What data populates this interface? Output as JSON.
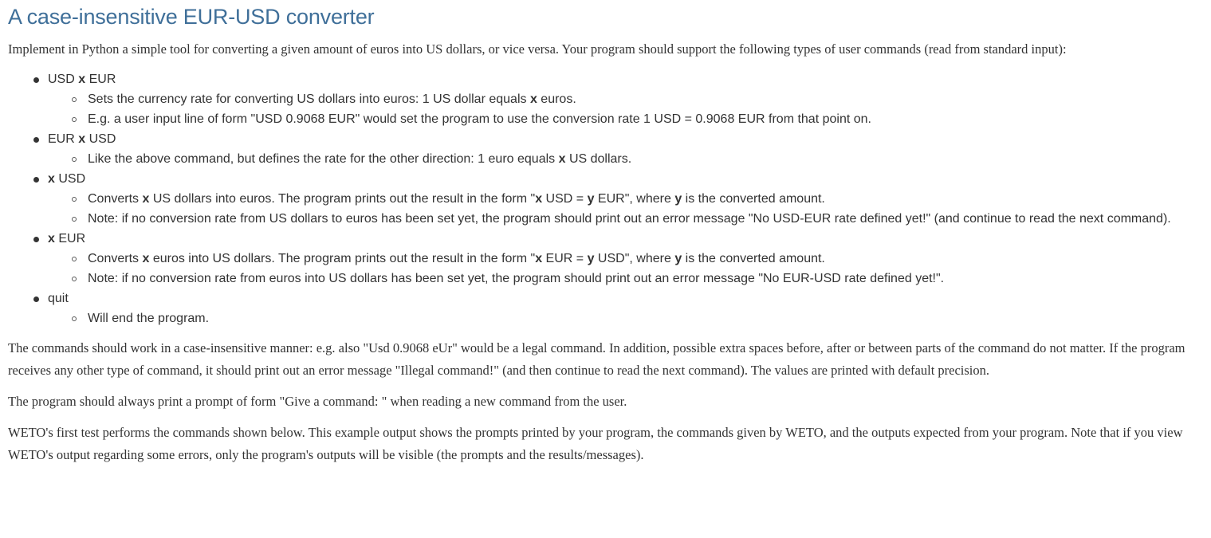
{
  "title": "A case-insensitive EUR-USD converter",
  "intro": "Implement in Python a simple tool for converting a given amount of euros into US dollars, or vice versa. Your program should support the following types of user commands (read from standard input):",
  "commands": [
    {
      "label": [
        {
          "t": "USD "
        },
        {
          "t": "x",
          "b": true
        },
        {
          "t": " EUR"
        }
      ],
      "details": [
        [
          {
            "t": "Sets the currency rate for converting US dollars into euros: 1 US dollar equals "
          },
          {
            "t": "x",
            "b": true
          },
          {
            "t": " euros."
          }
        ],
        [
          {
            "t": "E.g. a user input line of form \"USD 0.9068 EUR\" would set the program to use the conversion rate 1 USD = 0.9068 EUR from that point on."
          }
        ]
      ]
    },
    {
      "label": [
        {
          "t": "EUR "
        },
        {
          "t": "x",
          "b": true
        },
        {
          "t": " USD"
        }
      ],
      "details": [
        [
          {
            "t": "Like the above command, but defines the rate for the other direction: 1 euro equals "
          },
          {
            "t": "x",
            "b": true
          },
          {
            "t": " US dollars."
          }
        ]
      ]
    },
    {
      "label": [
        {
          "t": "x",
          "b": true
        },
        {
          "t": " USD"
        }
      ],
      "details": [
        [
          {
            "t": "Converts "
          },
          {
            "t": "x",
            "b": true
          },
          {
            "t": " US dollars into euros. The program prints out the result in the form \""
          },
          {
            "t": "x",
            "b": true
          },
          {
            "t": " USD = "
          },
          {
            "t": "y",
            "b": true
          },
          {
            "t": " EUR\", where "
          },
          {
            "t": "y",
            "b": true
          },
          {
            "t": " is the converted amount."
          }
        ],
        [
          {
            "t": "Note: if no conversion rate from US dollars to euros has been set yet, the program should print out an error message \"No USD-EUR rate defined yet!\" (and continue to read the next command)."
          }
        ]
      ]
    },
    {
      "label": [
        {
          "t": "x",
          "b": true
        },
        {
          "t": " EUR"
        }
      ],
      "details": [
        [
          {
            "t": "Converts "
          },
          {
            "t": "x",
            "b": true
          },
          {
            "t": " euros into US dollars. The program prints out the result in the form \""
          },
          {
            "t": "x",
            "b": true
          },
          {
            "t": " EUR = "
          },
          {
            "t": "y",
            "b": true
          },
          {
            "t": " USD\", where "
          },
          {
            "t": "y",
            "b": true
          },
          {
            "t": " is the converted amount."
          }
        ],
        [
          {
            "t": "Note: if no conversion rate from euros into US dollars has been set yet, the program should print out an error message \"No EUR-USD rate defined yet!\"."
          }
        ]
      ]
    },
    {
      "label": [
        {
          "t": "quit"
        }
      ],
      "details": [
        [
          {
            "t": "Will end the program."
          }
        ]
      ]
    }
  ],
  "paragraph_case": "The commands should work in a case-insensitive manner: e.g. also \"Usd 0.9068 eUr\" would be a legal command. In addition, possible extra spaces before, after or between parts of the command do not matter. If the program receives any other type of command, it should print out an error message \"Illegal command!\" (and then continue to read the next command). The values are printed with default precision.",
  "paragraph_prompt": "The program should always print a prompt of form \"Give a command: \" when reading a new command from the user.",
  "paragraph_weto": "WETO's first test performs the commands shown below. This example output shows the prompts printed by your program, the commands given by WETO, and the outputs expected from your program. Note that if you view WETO's output regarding some errors, only the program's outputs will be visible (the prompts and the results/messages).",
  "colors": {
    "title": "#3f6f99",
    "text": "#333333"
  }
}
